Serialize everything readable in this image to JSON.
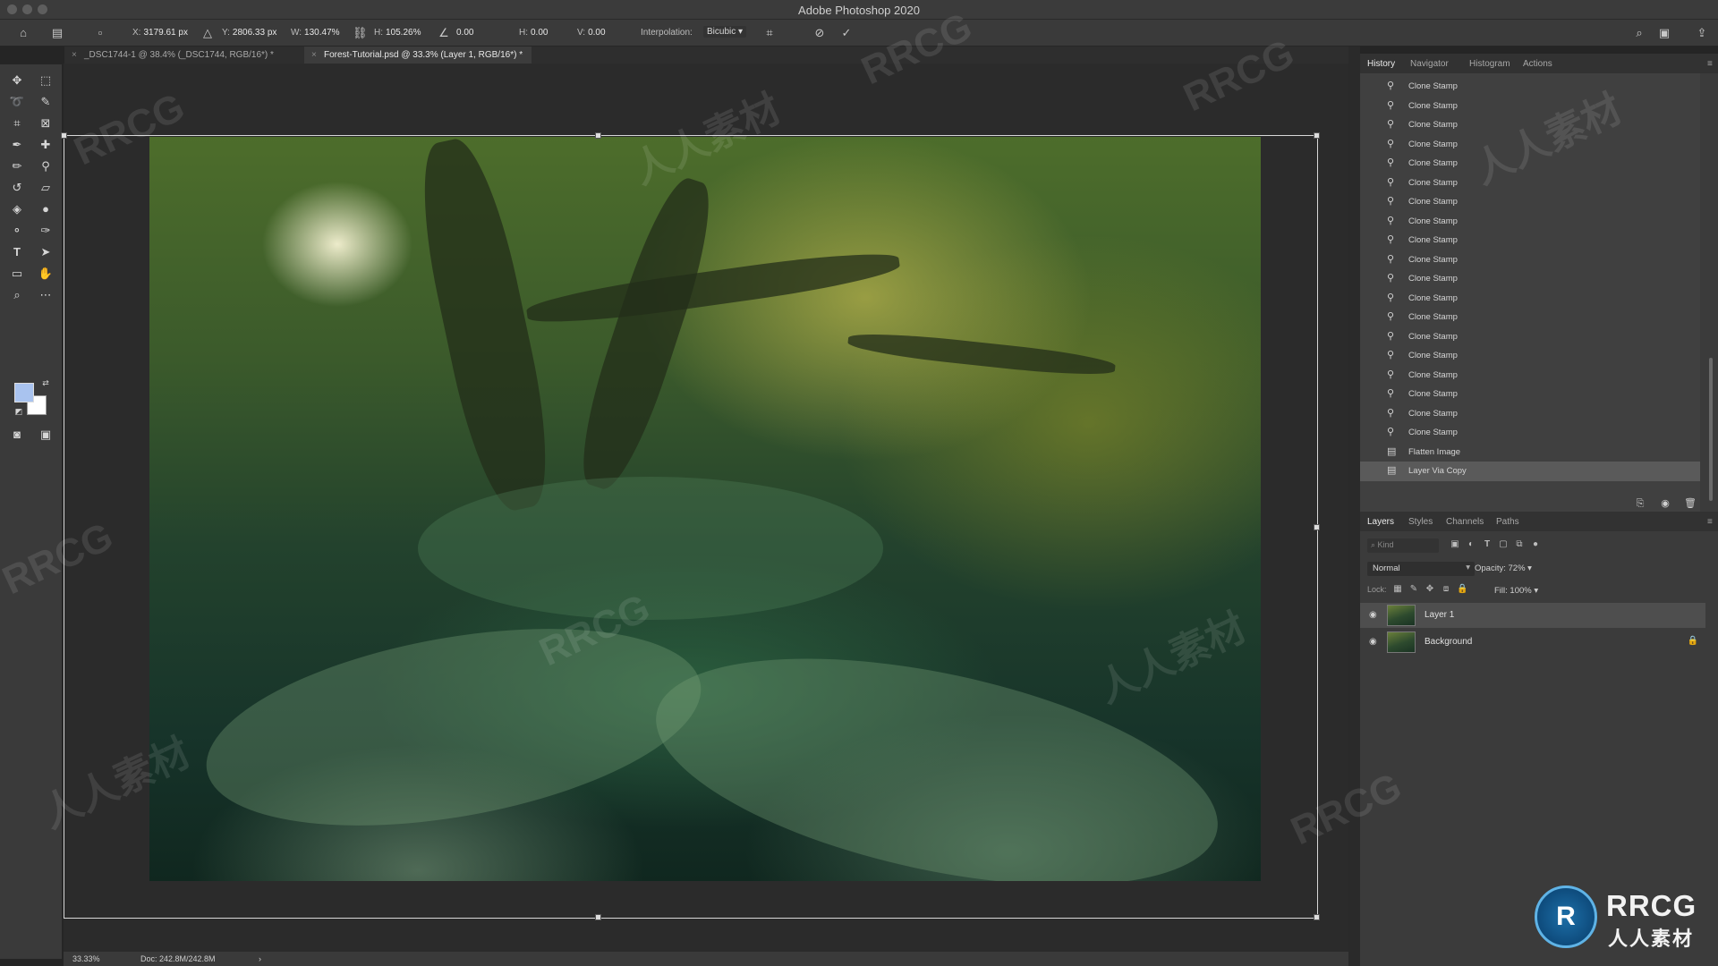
{
  "window": {
    "title": "Adobe Photoshop 2020"
  },
  "options_bar": {
    "x_label": "X:",
    "x_value": "3179.61 px",
    "y_label": "Y:",
    "y_value": "2806.33 px",
    "w_label": "W:",
    "w_value": "130.47%",
    "h_label": "H:",
    "h_value": "105.26%",
    "angle_value": "0.00",
    "hskew_label": "H:",
    "hskew_value": "0.00",
    "vskew_label": "V:",
    "vskew_value": "0.00",
    "interpolation_label": "Interpolation:",
    "interpolation_value": "Bicubic"
  },
  "doc_tabs": [
    {
      "label": "_DSC1744-1 @ 38.4% (_DSC1744, RGB/16*) *"
    },
    {
      "label": "Forest-Tutorial.psd @ 33.3% (Layer 1, RGB/16*) *"
    }
  ],
  "history_panel": {
    "tabs": [
      "History",
      "Navigator",
      "Histogram",
      "Actions"
    ],
    "items": [
      "Clone Stamp",
      "Clone Stamp",
      "Clone Stamp",
      "Clone Stamp",
      "Clone Stamp",
      "Clone Stamp",
      "Clone Stamp",
      "Clone Stamp",
      "Clone Stamp",
      "Clone Stamp",
      "Clone Stamp",
      "Clone Stamp",
      "Clone Stamp",
      "Clone Stamp",
      "Clone Stamp",
      "Clone Stamp",
      "Clone Stamp",
      "Clone Stamp",
      "Clone Stamp",
      "Flatten Image",
      "Layer Via Copy"
    ]
  },
  "layers_panel": {
    "tabs": [
      "Layers",
      "Styles",
      "Channels",
      "Paths"
    ],
    "search_placeholder": "Kind",
    "blend_mode": "Normal",
    "opacity_label": "Opacity:",
    "opacity_value": "72%",
    "lock_label": "Lock:",
    "fill_label": "Fill:",
    "fill_value": "100%",
    "layers": [
      {
        "name": "Layer 1"
      },
      {
        "name": "Background"
      }
    ]
  },
  "status_bar": {
    "zoom": "33.33%",
    "doc_size": "Doc: 242.8M/242.8M"
  },
  "watermark": {
    "brand": "RRCG",
    "brand_cn": "人人素材"
  },
  "colors": {
    "foreground": "#a9c3ef",
    "background": "#ffffff",
    "ui_bg": "#3a3a3a"
  }
}
